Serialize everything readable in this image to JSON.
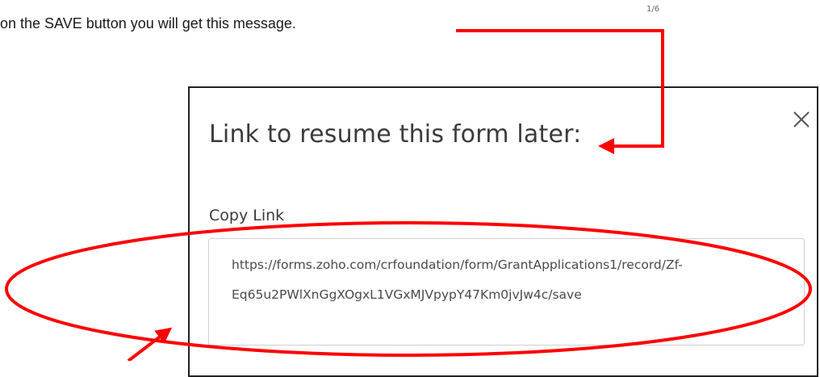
{
  "caption": "on the SAVE button you will get this message.",
  "page_number": "1/6",
  "dialog": {
    "title": "Link to resume this form later:",
    "copy_link_label": "Copy Link",
    "link_line_1": "https://forms.zoho.com/crfoundation/form/GrantApplications1/record/Zf-",
    "link_line_2": "Eq65u2PWlXnGgXOgxL1VGxMJVpypY47Km0jvJw4c/save",
    "close_icon": "close-icon"
  },
  "annotation_colors": {
    "arrow": "#ff0000",
    "highlight_ellipse": "#ff0000"
  }
}
